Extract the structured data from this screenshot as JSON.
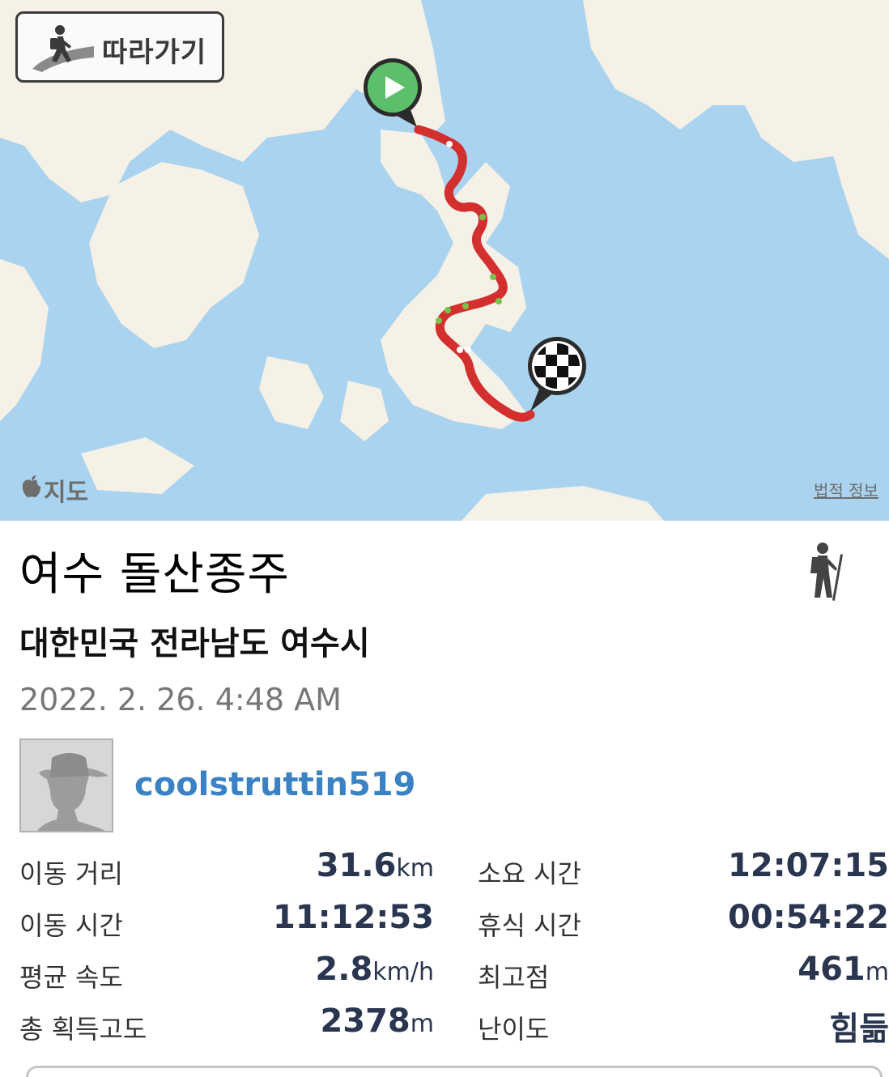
{
  "map": {
    "follow_button_label": "따라가기",
    "follow_icon": "hiker-on-path-icon",
    "brand_label": "지도",
    "brand_icon": "apple-logo-icon",
    "legal_link": "법적 정보",
    "start_marker_icon": "play-icon",
    "end_marker_icon": "checkered-flag-icon",
    "route_color": "#d32f2f",
    "water_color": "#a9d3ef",
    "land_color": "#f6f1e7"
  },
  "activity": {
    "title": "여수 돌산종주",
    "type_icon": "hiking-icon",
    "region": "대한민국 전라남도 여수시",
    "datetime": "2022. 2. 26. 4:48 AM",
    "user": {
      "avatar_icon": "default-avatar-icon",
      "username": "coolstruttin519"
    }
  },
  "stats": {
    "distance": {
      "label": "이동 거리",
      "value": "31.6",
      "unit": "km"
    },
    "total_time": {
      "label": "소요 시간",
      "value": "12:07:15",
      "unit": ""
    },
    "moving_time": {
      "label": "이동 시간",
      "value": "11:12:53",
      "unit": ""
    },
    "rest_time": {
      "label": "휴식 시간",
      "value": "00:54:22",
      "unit": ""
    },
    "avg_speed": {
      "label": "평균 속도",
      "value": "2.8",
      "unit": "km/h"
    },
    "max_elevation": {
      "label": "최고점",
      "value": "461",
      "unit": "m"
    },
    "total_ascent": {
      "label": "총 획득고도",
      "value": "2378",
      "unit": "m"
    },
    "difficulty": {
      "label": "난이도",
      "value": "힘듦",
      "unit": ""
    }
  }
}
